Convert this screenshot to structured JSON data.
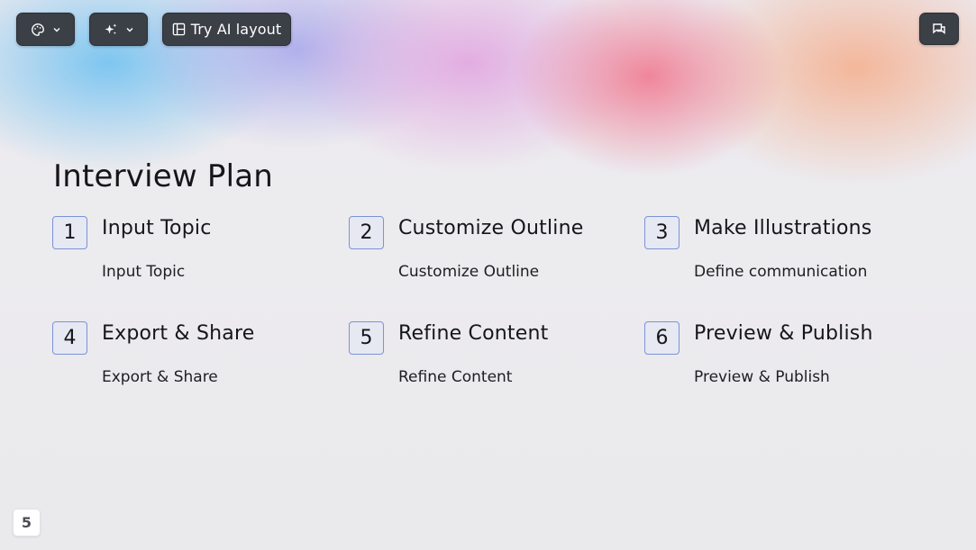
{
  "toolbar": {
    "theme_icon": "palette-icon",
    "ai_icon": "sparkles-icon",
    "layout_icon": "layout-icon",
    "layout_label": "Try AI layout",
    "comment_icon": "comment-icon"
  },
  "slide": {
    "title": "Interview Plan",
    "steps": [
      {
        "number": "1",
        "title": "Input Topic",
        "description": "Input Topic"
      },
      {
        "number": "2",
        "title": "Customize Outline",
        "description": "Customize Outline"
      },
      {
        "number": "3",
        "title": "Make Illustrations",
        "description": "Define communication"
      },
      {
        "number": "4",
        "title": "Export & Share",
        "description": "Export & Share"
      },
      {
        "number": "5",
        "title": "Refine Content",
        "description": "Refine Content"
      },
      {
        "number": "6",
        "title": "Preview & Publish",
        "description": "Preview & Publish"
      }
    ]
  },
  "page_number": "5",
  "colors": {
    "toolbar_bg": "#3b3f46",
    "number_border": "#7b93d6",
    "text": "#15161a"
  }
}
